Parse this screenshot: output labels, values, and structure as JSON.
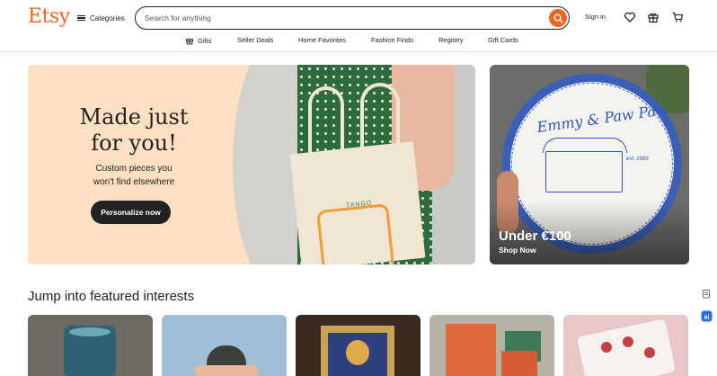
{
  "header": {
    "logo": "Etsy",
    "categories_label": "Categories",
    "search_placeholder": "Search for anything",
    "signin_label": "Sign in",
    "icons": [
      "heart-icon",
      "gift-icon",
      "cart-icon"
    ]
  },
  "subnav": {
    "items": [
      "Gifts",
      "Seller Deals",
      "Home Favorites",
      "Fashion Finds",
      "Registry",
      "Gift Cards"
    ]
  },
  "hero": {
    "title_line1": "Made just",
    "title_line2": "for you!",
    "subtitle_line1": "Custom pieces you",
    "subtitle_line2": "won't find elsewhere",
    "button_label": "Personalize now",
    "bag_text": "TANGO"
  },
  "promo": {
    "price_label": "Under €100",
    "link_label": "Shop Now",
    "plate_text": "Emmy & Paw Paw",
    "plate_est": "est. 1989"
  },
  "interests": {
    "title": "Jump into featured interests"
  },
  "colors": {
    "brand": "#f1641e",
    "hero_bg": "#fddfc2",
    "dark_button": "#222222",
    "plate_blue": "#3b5fb8"
  }
}
